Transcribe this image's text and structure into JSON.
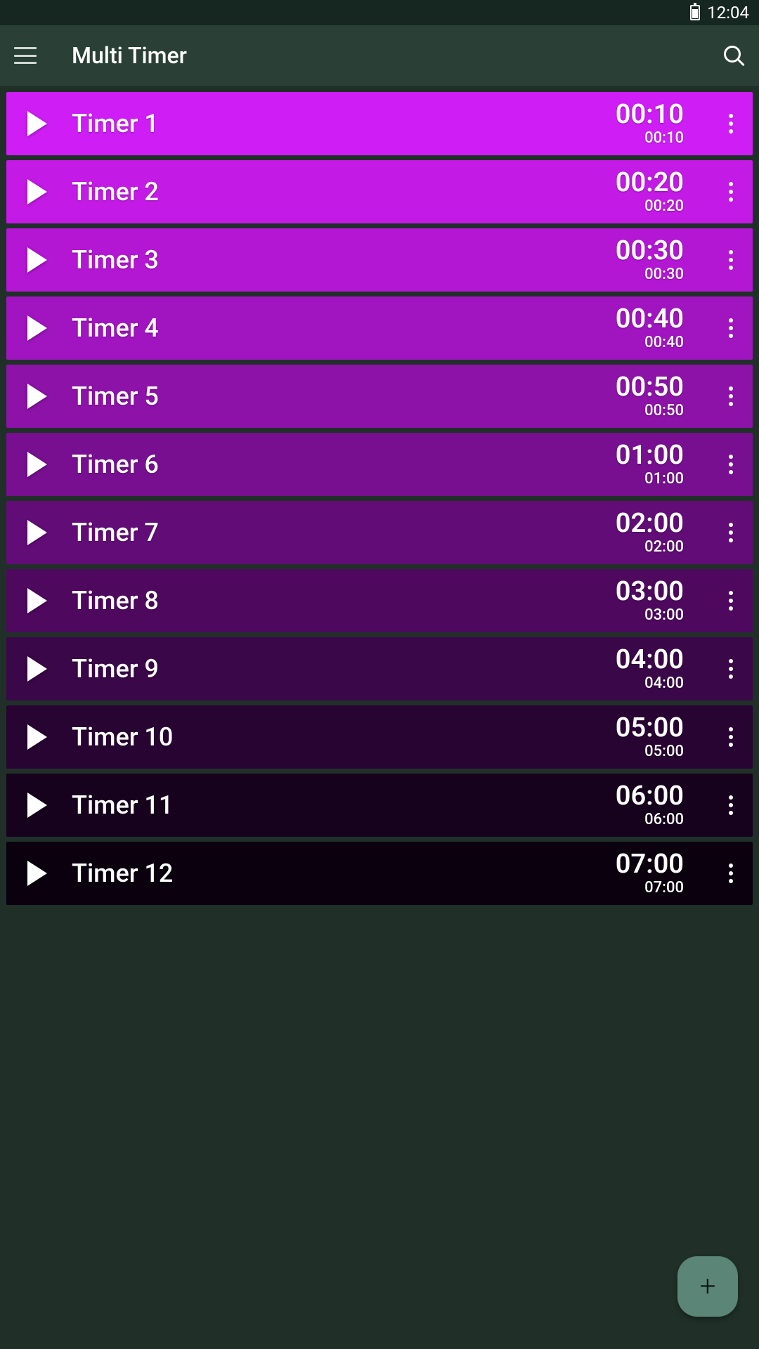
{
  "status": {
    "time": "12:04"
  },
  "appBar": {
    "title": "Multi Timer"
  },
  "timers": [
    {
      "name": "Timer 1",
      "main": "00:10",
      "sub": "00:10",
      "bg": "#cf1ef5"
    },
    {
      "name": "Timer 2",
      "main": "00:20",
      "sub": "00:20",
      "bg": "#c41ae6"
    },
    {
      "name": "Timer 3",
      "main": "00:30",
      "sub": "00:30",
      "bg": "#b317d3"
    },
    {
      "name": "Timer 4",
      "main": "00:40",
      "sub": "00:40",
      "bg": "#a015c0"
    },
    {
      "name": "Timer 5",
      "main": "00:50",
      "sub": "00:50",
      "bg": "#8c12a8"
    },
    {
      "name": "Timer 6",
      "main": "01:00",
      "sub": "01:00",
      "bg": "#770f90"
    },
    {
      "name": "Timer 7",
      "main": "02:00",
      "sub": "02:00",
      "bg": "#620c77"
    },
    {
      "name": "Timer 8",
      "main": "03:00",
      "sub": "03:00",
      "bg": "#4e095f"
    },
    {
      "name": "Timer 9",
      "main": "04:00",
      "sub": "04:00",
      "bg": "#3a0748"
    },
    {
      "name": "Timer 10",
      "main": "05:00",
      "sub": "05:00",
      "bg": "#280432"
    },
    {
      "name": "Timer 11",
      "main": "06:00",
      "sub": "06:00",
      "bg": "#17021d"
    },
    {
      "name": "Timer 12",
      "main": "07:00",
      "sub": "07:00",
      "bg": "#0a000e"
    }
  ]
}
